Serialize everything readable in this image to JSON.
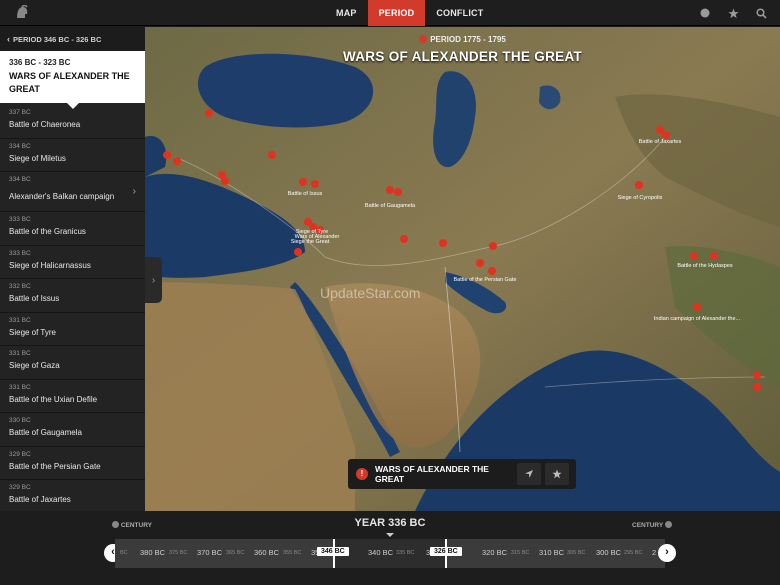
{
  "topbar": {
    "tabs": [
      {
        "label": "MAP"
      },
      {
        "label": "PERIOD"
      },
      {
        "label": "CONFLICT"
      }
    ],
    "active_tab": "PERIOD",
    "icons": [
      "info-icon",
      "star-icon",
      "search-icon"
    ]
  },
  "sidebar": {
    "back_label": "PERIOD 346 BC - 326 BC",
    "current": {
      "date": "336 BC - 323 BC",
      "title": "WARS OF ALEXANDER THE GREAT"
    },
    "items": [
      {
        "year": "337 BC",
        "name": "Battle of Chaeronea"
      },
      {
        "year": "334 BC",
        "name": "Siege of Miletus"
      },
      {
        "year": "334 BC",
        "name": "Alexander's Balkan campaign"
      },
      {
        "year": "333 BC",
        "name": "Battle of the Granicus"
      },
      {
        "year": "333 BC",
        "name": "Siege of Halicarnassus"
      },
      {
        "year": "332 BC",
        "name": "Battle of Issus"
      },
      {
        "year": "331 BC",
        "name": "Siege of Tyre"
      },
      {
        "year": "331 BC",
        "name": "Siege of Gaza"
      },
      {
        "year": "331 BC",
        "name": "Battle of the Uxian Defile"
      },
      {
        "year": "330 BC",
        "name": "Battle of Gaugamela"
      },
      {
        "year": "329 BC",
        "name": "Battle of the Persian Gate"
      },
      {
        "year": "329 BC",
        "name": "Battle of Jaxartes"
      }
    ]
  },
  "map": {
    "period_label": "PERIOD 1775 - 1795",
    "title": "WARS OF ALEXANDER THE GREAT",
    "watermark": "UpdateStar.com",
    "labels": [
      "Battle of Issus",
      "Siege of Tyre",
      "Wars of Alexander",
      "Siege the Great",
      "Battle of Gaugamela",
      "Battle of the Persian Gate",
      "Battle of the Hydaspes",
      "Indian campaign of Alexander the...",
      "Siege of Cyropolis",
      "Battle of Jaxartes"
    ],
    "info_bar": {
      "title": "WARS OF ALEXANDER THE GREAT"
    },
    "colors": {
      "accent": "#d23a2b",
      "sea": "#1d3a66",
      "land": "#7d7350"
    }
  },
  "timeline": {
    "year_label": "YEAR 336 BC",
    "century_left": "CENTURY",
    "century_right": "CENTURY",
    "ticks": [
      {
        "label": "BC",
        "small": true
      },
      {
        "label": "380 BC",
        "small": false
      },
      {
        "label": "375 BC",
        "small": true
      },
      {
        "label": "370 BC",
        "small": false
      },
      {
        "label": "365 BC",
        "small": true
      },
      {
        "label": "360 BC",
        "small": false
      },
      {
        "label": "355 BC",
        "small": true
      },
      {
        "label": "350 BC",
        "small": false
      },
      {
        "label": "340 BC",
        "small": false
      },
      {
        "label": "335 BC",
        "small": true
      },
      {
        "label": "3",
        "small": false
      },
      {
        "label": "320 BC",
        "small": false
      },
      {
        "label": "315 BC",
        "small": true
      },
      {
        "label": "310 BC",
        "small": false
      },
      {
        "label": "305 BC",
        "small": true
      },
      {
        "label": "300 BC",
        "small": false
      },
      {
        "label": "295 BC",
        "small": true
      },
      {
        "label": "2",
        "small": false
      }
    ],
    "start_handle": "346 BC",
    "end_handle": "326 BC"
  }
}
